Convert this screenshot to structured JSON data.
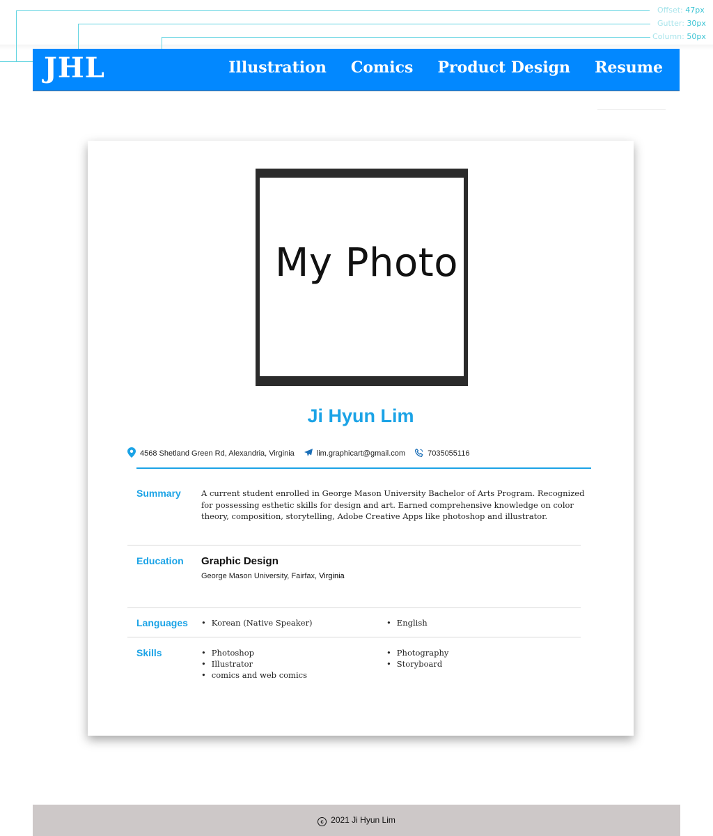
{
  "guides": {
    "offset_label": "Offset:",
    "offset_value": "47px",
    "gutter_label": "Gutter:",
    "gutter_value": "30px",
    "column_label": "Column:",
    "column_value": "50px"
  },
  "nav": {
    "logo": "JHL",
    "links": [
      "Illustration",
      "Comics",
      "Product Design",
      "Resume"
    ]
  },
  "resume": {
    "photo_placeholder": "My Photo",
    "name": "Ji Hyun Lim",
    "contact": {
      "address": "4568 Shetland Green Rd, Alexandria, Virginia",
      "email": "lim.graphicart@gmail.com",
      "phone": "7035055116"
    },
    "summary": {
      "label": "Summary",
      "text": "A current student enrolled in George Mason University Bachelor of Arts Program. Recognized for possessing esthetic skills for design and art. Earned comprehensive knowledge on color theory, composition, storytelling, Adobe Creative Apps like photoshop and illustrator."
    },
    "education": {
      "label": "Education",
      "degree": "Graphic Design",
      "school": "George Mason University, Fairfax, ",
      "state": "Virginia"
    },
    "languages": {
      "label": "Languages",
      "col1": [
        "Korean (Native Speaker)"
      ],
      "col2": [
        "English"
      ]
    },
    "skills": {
      "label": "Skills",
      "col1": [
        "Photoshop",
        "Illustrator",
        "comics and web comics"
      ],
      "col2": [
        "Photography",
        "Storyboard"
      ]
    }
  },
  "footer": {
    "copyright": "2021 Ji Hyun Lim"
  },
  "colors": {
    "nav_bg": "#0288ff",
    "accent": "#1ba3e6",
    "footer_bg": "#cdc8c8"
  }
}
